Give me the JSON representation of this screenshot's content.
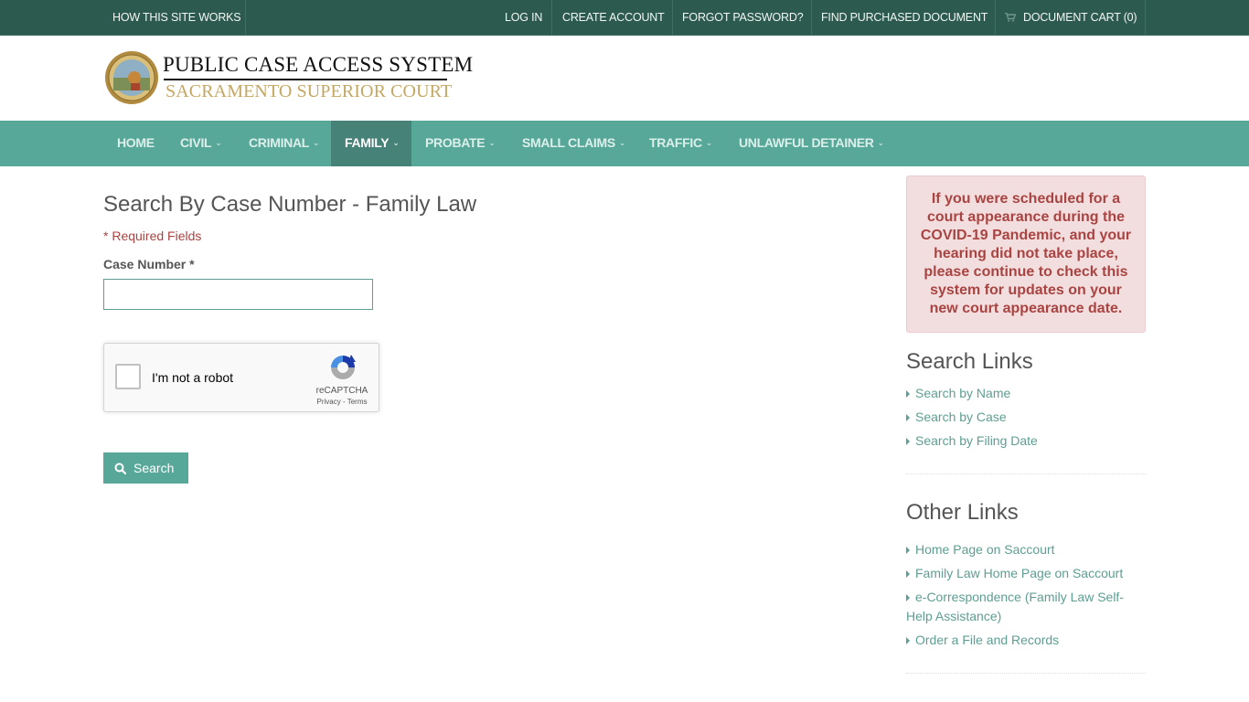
{
  "topbar": {
    "how_it_works": "HOW THIS SITE WORKS",
    "log_in": "LOG IN",
    "create_account": "CREATE ACCOUNT",
    "forgot_password": "FORGOT PASSWORD?",
    "find_purchased": "FIND PURCHASED DOCUMENT",
    "document_cart": "DOCUMENT CART (0)",
    "cart_icon": "shopping-cart-icon"
  },
  "header": {
    "seal_icon": "court-seal-logo",
    "title": "PUBLIC CASE ACCESS SYSTEM",
    "subtitle": "SACRAMENTO SUPERIOR COURT"
  },
  "nav": {
    "items": [
      {
        "label": "HOME",
        "dropdown": false
      },
      {
        "label": "CIVIL",
        "dropdown": true
      },
      {
        "label": "CRIMINAL",
        "dropdown": true
      },
      {
        "label": "FAMILY",
        "dropdown": true,
        "active": true
      },
      {
        "label": "PROBATE",
        "dropdown": true
      },
      {
        "label": "SMALL CLAIMS",
        "dropdown": true
      },
      {
        "label": "TRAFFIC",
        "dropdown": true
      },
      {
        "label": "UNLAWFUL DETAINER",
        "dropdown": true
      }
    ],
    "chevron": "⌄"
  },
  "form": {
    "title": "Search By Case Number - Family Law",
    "required_note": "* Required Fields",
    "case_number_label": "Case Number *",
    "case_number_value": "",
    "case_number_placeholder": "",
    "recaptcha": {
      "label": "I'm not a robot",
      "brand": "reCAPTCHA",
      "links": "Privacy - Terms"
    },
    "search_button": "Search"
  },
  "sidebar": {
    "alert": "If you were scheduled for a court appearance during the COVID-19 Pandemic, and your hearing did not take place, please continue to check this system for updates on your new court appearance date.",
    "search_links_title": "Search Links",
    "search_links": [
      "Search by Name",
      "Search by Case",
      "Search by Filing Date"
    ],
    "other_links_title": "Other Links",
    "other_links": [
      "Home Page on Saccourt",
      "Family Law Home Page on Saccourt",
      "e-Correspondence (Family Law Self-Help Assistance)",
      "Order a File and Records"
    ]
  },
  "colors": {
    "topbar": "#2d5a4f",
    "nav": "#58a89a",
    "nav_active": "#468277",
    "link": "#5e9e92",
    "alert_bg": "#f2dede",
    "alert_text": "#a94442",
    "logo_gold": "#c4a862"
  }
}
